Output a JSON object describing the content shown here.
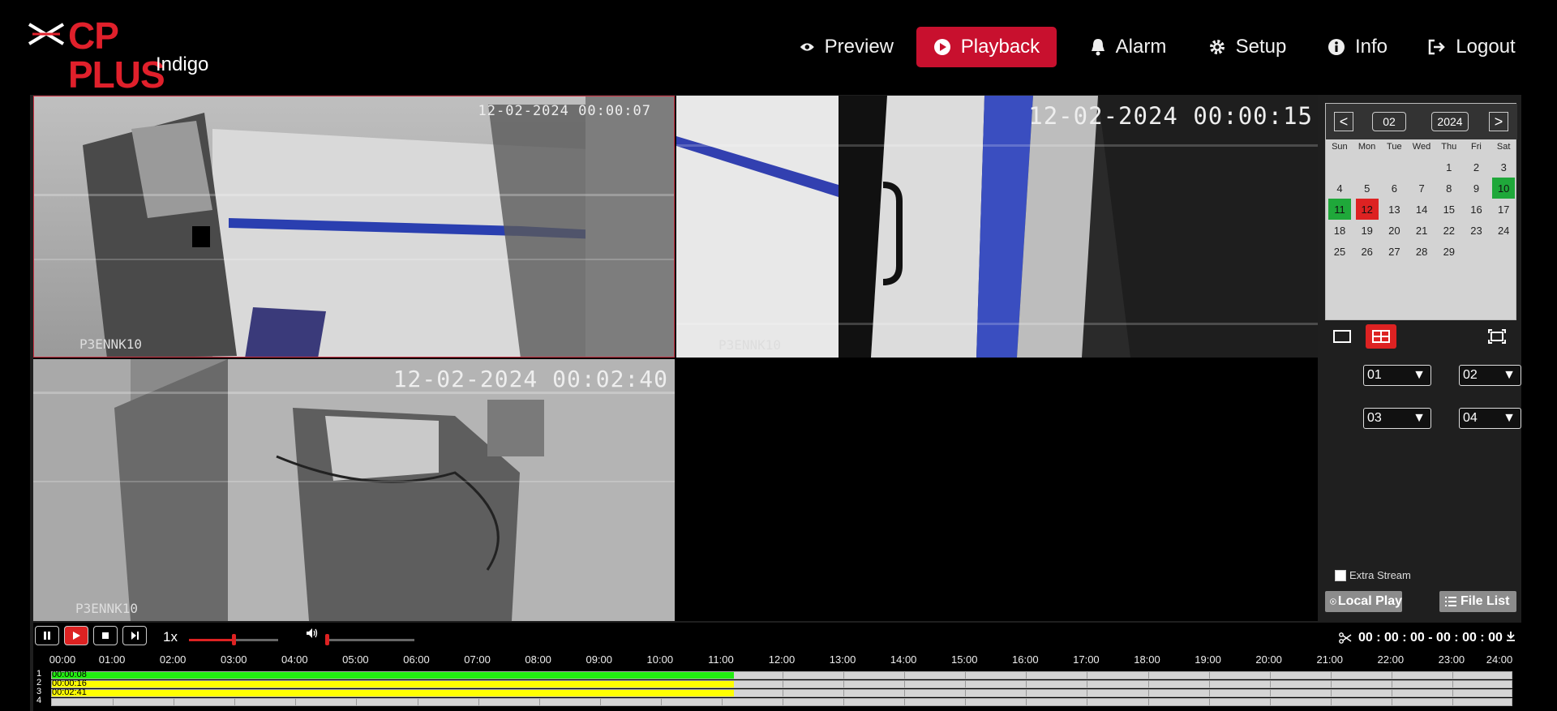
{
  "app": {
    "brand": "CP PLUS",
    "sub_brand": "Indigo"
  },
  "nav": [
    {
      "label": "Preview",
      "icon": "eye-icon",
      "active": false
    },
    {
      "label": "Playback",
      "icon": "play-circle-icon",
      "active": true
    },
    {
      "label": "Alarm",
      "icon": "bell-icon",
      "active": false
    },
    {
      "label": "Setup",
      "icon": "gear-icon",
      "active": false
    },
    {
      "label": "Info",
      "icon": "info-icon",
      "active": false
    },
    {
      "label": "Logout",
      "icon": "logout-icon",
      "active": false
    }
  ],
  "colors": {
    "accent": "#c8102e",
    "record": "#22ee11",
    "motion": "#ffff00",
    "cal_record": "#1fa83a",
    "cal_selected": "#dd2222"
  },
  "video": [
    {
      "channel": 1,
      "timestamp": "12-02-2024 00:00:07",
      "name": "P3ENNK10"
    },
    {
      "channel": 2,
      "timestamp": "12-02-2024 00:00:15",
      "name": "P3ENNK10"
    },
    {
      "channel": 3,
      "timestamp": "12-02-2024 00:02:40",
      "name": "P3ENNK10"
    },
    {
      "channel": 4,
      "timestamp": "",
      "name": ""
    }
  ],
  "calendar": {
    "prev": "<",
    "next": ">",
    "month": "02",
    "year": "2024",
    "weekdays": [
      "Sun",
      "Mon",
      "Tue",
      "Wed",
      "Thu",
      "Fri",
      "Sat"
    ],
    "days": [
      "1",
      "2",
      "3",
      "4",
      "5",
      "6",
      "7",
      "8",
      "9",
      "10",
      "11",
      "12",
      "13",
      "14",
      "15",
      "16",
      "17",
      "18",
      "19",
      "20",
      "21",
      "22",
      "23",
      "24",
      "25",
      "26",
      "27",
      "28",
      "29"
    ],
    "first_weekday": 4,
    "recorded_days": [
      "10",
      "11"
    ],
    "selected_day": "12"
  },
  "layout_buttons": [
    "single-view-icon",
    "quad-view-icon",
    "fullscreen-icon"
  ],
  "channel_selects": [
    "01",
    "02",
    "03",
    "04"
  ],
  "extra_stream": {
    "label": "Extra Stream",
    "checked": false
  },
  "buttons": {
    "local_play": "Local Play",
    "file_list": "File List"
  },
  "controls": {
    "speed": "1x",
    "time_range": "00 : 00 : 00 - 00 : 00 : 00",
    "progress": 0.5,
    "volume": 0.0
  },
  "timeline": {
    "hours": [
      "00:00",
      "01:00",
      "02:00",
      "03:00",
      "04:00",
      "05:00",
      "06:00",
      "07:00",
      "08:00",
      "09:00",
      "10:00",
      "11:00",
      "12:00",
      "13:00",
      "14:00",
      "15:00",
      "16:00",
      "17:00",
      "18:00",
      "19:00",
      "20:00",
      "21:00",
      "22:00",
      "23:00",
      "24:00"
    ],
    "rows": [
      {
        "num": "1",
        "time": "00:00:08",
        "color": "#22ee11",
        "end_hour": 11.2
      },
      {
        "num": "2",
        "time": "00:00:16",
        "color": "#ffff00",
        "end_hour": 11.2
      },
      {
        "num": "3",
        "time": "00:02:41",
        "color": "#ffff00",
        "end_hour": 11.2
      },
      {
        "num": "4",
        "time": "",
        "color": "",
        "end_hour": 0
      }
    ]
  }
}
